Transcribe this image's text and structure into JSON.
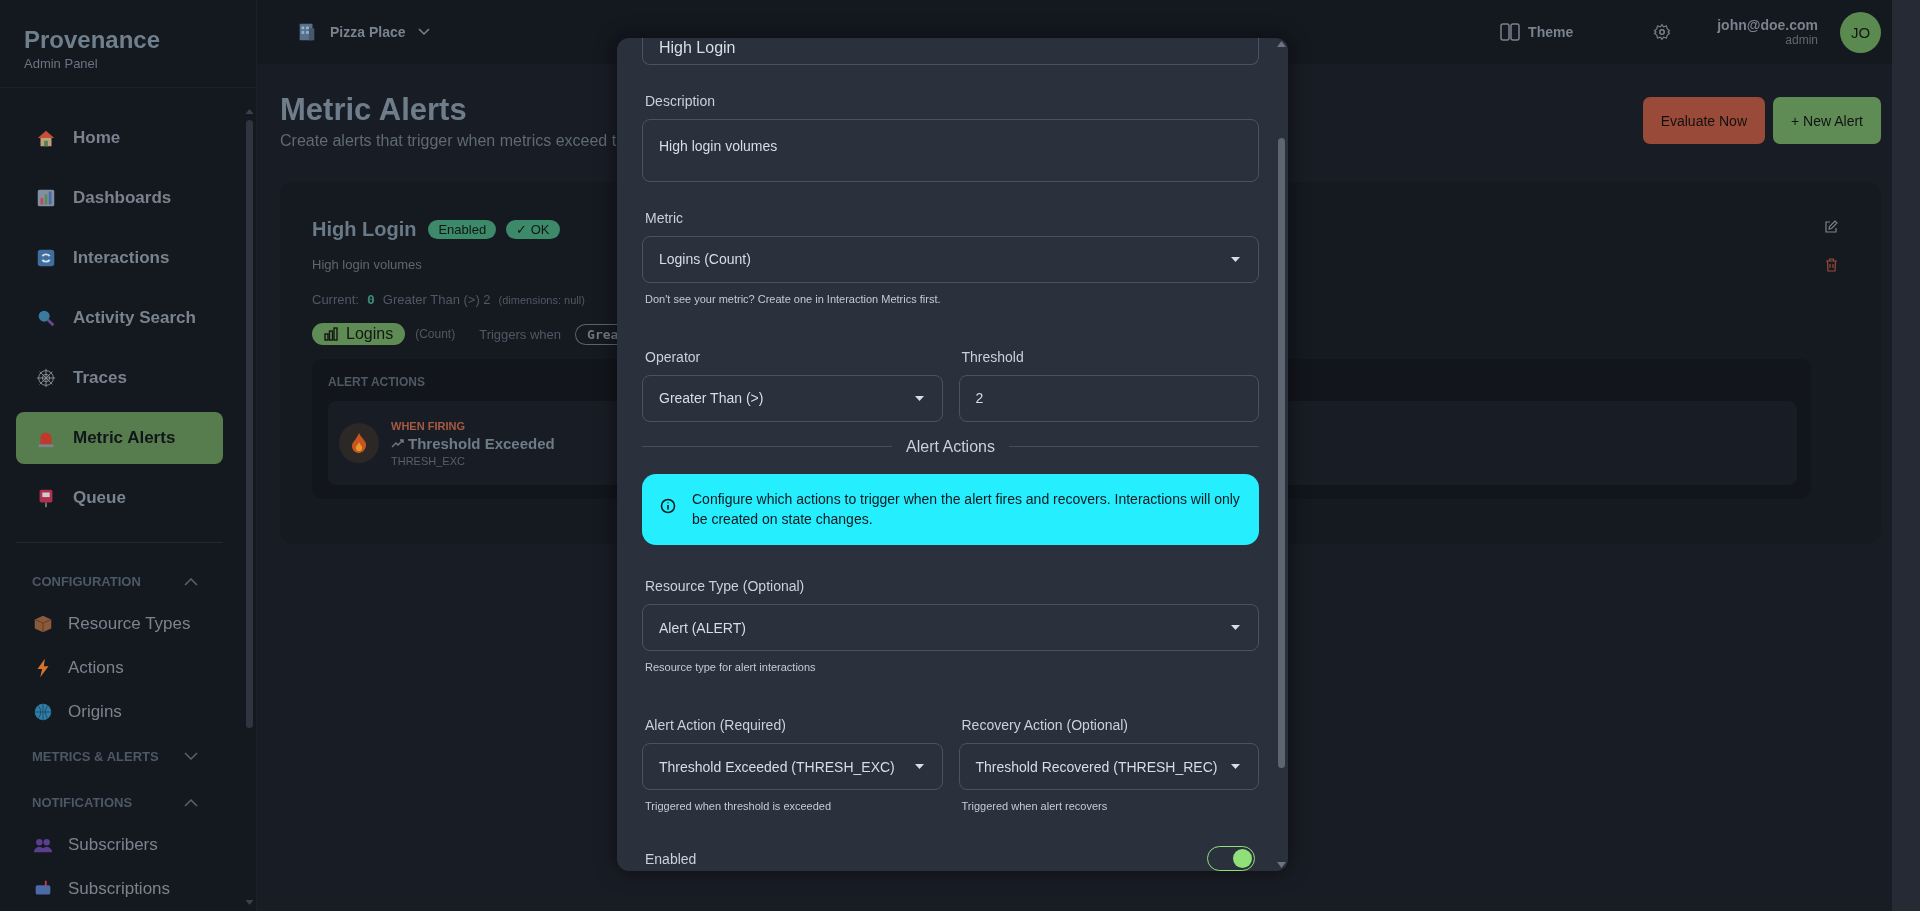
{
  "sidebar": {
    "brand": "Provenance",
    "subtitle": "Admin Panel",
    "nav": [
      {
        "label": "Home",
        "selected": false
      },
      {
        "label": "Dashboards",
        "selected": false
      },
      {
        "label": "Interactions",
        "selected": false
      },
      {
        "label": "Activity Search",
        "selected": false
      },
      {
        "label": "Traces",
        "selected": false
      },
      {
        "label": "Metric Alerts",
        "selected": true
      },
      {
        "label": "Queue",
        "selected": false
      }
    ],
    "sections": [
      {
        "title": "CONFIGURATION",
        "expanded": true,
        "items": [
          "Resource Types",
          "Actions",
          "Origins"
        ]
      },
      {
        "title": "METRICS & ALERTS",
        "expanded": false
      },
      {
        "title": "NOTIFICATIONS",
        "expanded": true,
        "items": [
          "Subscribers",
          "Subscriptions"
        ]
      }
    ]
  },
  "header": {
    "workspace": "Pizza Place",
    "theme_button": "Theme",
    "user": {
      "email": "john@doe.com",
      "role": "admin",
      "initials": "JO"
    }
  },
  "page": {
    "title": "Metric Alerts",
    "subtitle": "Create alerts that trigger when metrics exceed t",
    "buttons": [
      {
        "label": "Evaluate Now",
        "kind": "danger"
      },
      {
        "label": "+ New Alert",
        "kind": "primary"
      }
    ]
  },
  "alert_card": {
    "title": "High Login",
    "badges": [
      "Enabled",
      "✓ OK"
    ],
    "description": "High login volumes",
    "current": {
      "label": "Current:",
      "value": "0",
      "condition": "Greater Than (>) 2",
      "dimensions": "(dimensions: null)"
    },
    "metric_pill": "Logins",
    "metric_type": "(Count)",
    "triggers_label": "Triggers when",
    "operator_pill": "Grea",
    "actions": {
      "title": "ALERT ACTIONS",
      "items": [
        {
          "when": "WHEN FIRING",
          "name": "Threshold Exceeded",
          "code": "THRESH_EXC"
        }
      ]
    }
  },
  "modal": {
    "name_value": "High Login",
    "description": {
      "label": "Description",
      "value": "High login volumes"
    },
    "metric": {
      "label": "Metric",
      "value": "Logins (Count)",
      "help": "Don't see your metric? Create one in Interaction Metrics first."
    },
    "operator": {
      "label": "Operator",
      "value": "Greater Than (>)"
    },
    "threshold": {
      "label": "Threshold",
      "value": "2"
    },
    "section_title": "Alert Actions",
    "info": "Configure which actions to trigger when the alert fires and recovers. Interactions will only be created on state changes.",
    "resource_type": {
      "label": "Resource Type (Optional)",
      "value": "Alert (ALERT)",
      "help": "Resource type for alert interactions"
    },
    "alert_action": {
      "label": "Alert Action (Required)",
      "value": "Threshold Exceeded (THRESH_EXC)",
      "help": "Triggered when threshold is exceeded"
    },
    "recovery_action": {
      "label": "Recovery Action (Optional)",
      "value": "Threshold Recovered (THRESH_REC)",
      "help": "Triggered when alert recovers"
    },
    "enabled": {
      "label": "Enabled",
      "on": true
    }
  }
}
